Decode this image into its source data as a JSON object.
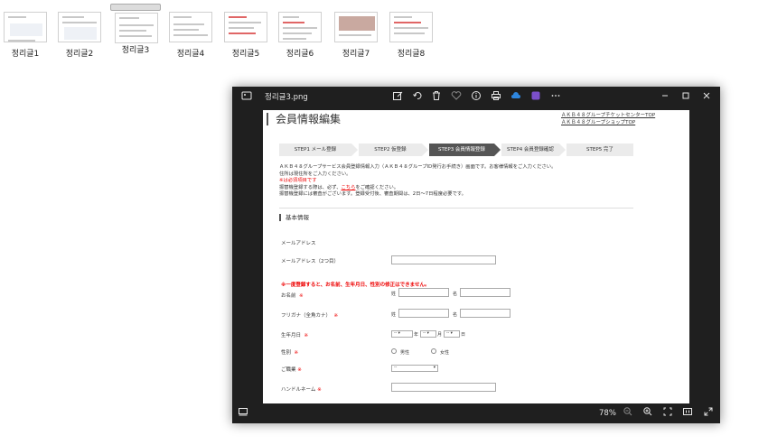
{
  "thumbnails": [
    {
      "label": "정리글1",
      "selected": false
    },
    {
      "label": "정리글2",
      "selected": false
    },
    {
      "label": "정리글3",
      "selected": true
    },
    {
      "label": "정리글4",
      "selected": false
    },
    {
      "label": "정리글5",
      "selected": false
    },
    {
      "label": "정리글6",
      "selected": false
    },
    {
      "label": "정리글7",
      "selected": false
    },
    {
      "label": "정리글8",
      "selected": false
    }
  ],
  "viewer": {
    "file_name": "정리글3.png",
    "zoom": "78%",
    "accent": "#1f1f1f"
  },
  "page": {
    "title": "会員情報編集",
    "links": [
      "ＡＫＢ４８グループチケットセンターTOP",
      "ＡＫＢ４８グループショップTOP"
    ],
    "steps": [
      "STEP1 メール登録",
      "STEP2 仮登録",
      "STEP3 会員情報登録",
      "STEP4 会員登録確認",
      "STEP5 完了"
    ],
    "active_step_color": "#555555",
    "intro": {
      "line1": "ＡＫＢ４８グループサービス会員登録情報入力（ＡＫＢ４８グループID発行お手続き）画面です。お客様情報をご入力ください。",
      "line2": "住所は現住所をご入力ください。",
      "line3": "※は必須項目です",
      "line4_pre": "振替機登録する際は、必ず、",
      "line4_link": "こちら",
      "line4_post": "をご確認ください。",
      "line5": "振替機登録には審査がございます。登録受付後、審査期間は、2日〜7日程度必要です。"
    },
    "section_title": "基本情報",
    "fields": {
      "email": "メールアドレス",
      "email2": "メールアドレス（2つ目）",
      "warning": "※一度登録すると、お名前、生年月日、性別の修正はできません。",
      "name": "お名前",
      "kana": "フリガナ（全角カナ）",
      "birthday": "生年月日",
      "gender": "性別",
      "job": "ご職業",
      "handle": "ハンドルネーム",
      "req_mark": "※",
      "sei": "姓",
      "mei": "名",
      "year": "年",
      "month": "月",
      "day": "日",
      "male": "男性",
      "female": "女性",
      "dash": "--",
      "job_default": "--"
    }
  }
}
